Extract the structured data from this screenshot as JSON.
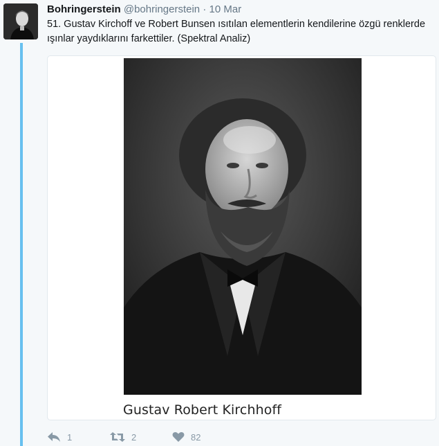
{
  "tweet": {
    "author_name": "Bohringerstein",
    "author_handle": "@bohringerstein",
    "separator": "·",
    "timestamp": "10 Mar",
    "text": "51. Gustav Kirchoff ve Robert Bunsen ısıtılan elementlerin kendilerine özgü renklerde ışınlar yaydıklarını farkettiler. (Spektral Analiz)"
  },
  "media": {
    "caption": "Gustav Robert Kirchhoff"
  },
  "actions": {
    "reply_count": "1",
    "retweet_count": "2",
    "like_count": "82"
  },
  "icons": {
    "avatar": "avatar-portrait",
    "reply": "reply-icon",
    "retweet": "retweet-icon",
    "like": "heart-icon"
  },
  "colors": {
    "thread_line": "#67c0ef",
    "background": "#f5f8fa",
    "action_gray": "#8899a6"
  }
}
